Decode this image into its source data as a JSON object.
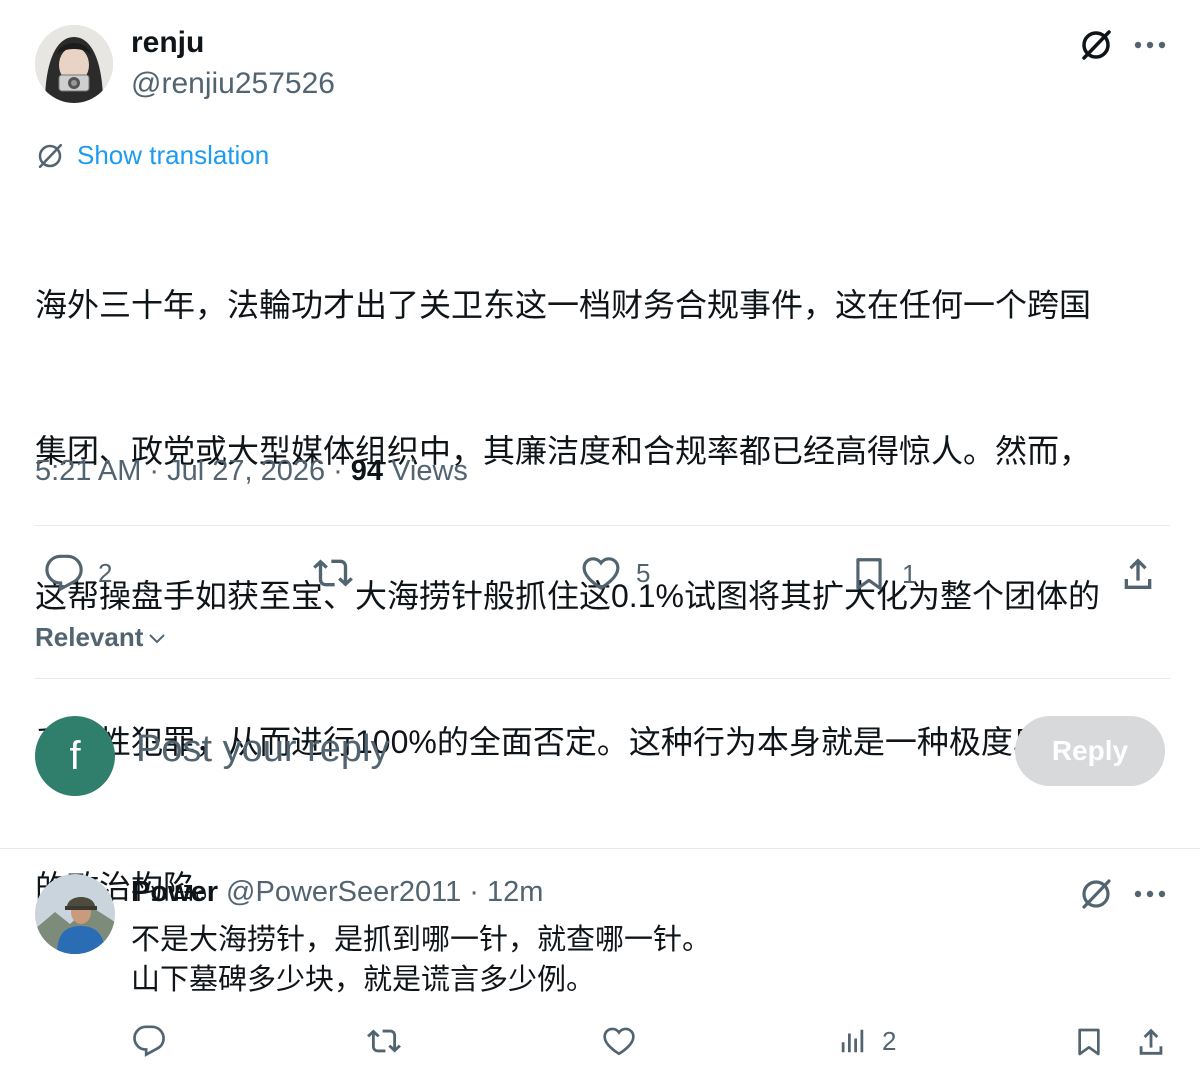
{
  "post": {
    "author": {
      "display_name": "renju",
      "handle": "@renjiu257526",
      "avatar": "avatar-photo"
    },
    "translate_label": "Show translation",
    "text": "海外三十年，法輪功才出了关卫东这一档财务合规事件，这在任何一个跨国集团、政党或大型媒体组织中，其廉洁度和合规率都已经高得惊人。然而，这帮操盘手如获至宝、大海捞针般抓住这0.1%试图将其扩大化为整个团体的系统性犯罪，从而进行100%的全面否定。这种行为本身就是一种极度卑劣的政治构陷。",
    "text_lines": [
      "海外三十年，法輪功才出了关卫东这一档财务合规事件，这在任何一个跨国",
      "集团、政党或大型媒体组织中，其廉洁度和合规率都已经高得惊人。然而，",
      "这帮操盘手如获至宝、大海捞针般抓住这0.1%试图将其扩大化为整个团体的",
      "系统性犯罪，从而进行100%的全面否定。这种行为本身就是一种极度卑劣",
      "的政治构陷。"
    ],
    "time": "5:21 AM",
    "date": "Jul 27, 2026",
    "separator": "·",
    "views_count": "94",
    "views_label": "Views",
    "actions": {
      "replies": "2",
      "reposts": "",
      "likes": "5",
      "bookmarks": "1"
    }
  },
  "sort": {
    "label": "Relevant"
  },
  "composer": {
    "avatar_letter": "f",
    "placeholder": "Post your reply",
    "button_label": "Reply",
    "avatar_color": "#2f7f6c"
  },
  "reply": {
    "author": {
      "display_name": "Power",
      "handle": "@PowerSeer2011",
      "time": "12m"
    },
    "separator": "·",
    "lines": [
      "不是大海捞针，是抓到哪一针，就查哪一针。",
      "山下墓碑多少块，就是谎言多少例。"
    ],
    "actions": {
      "views": "2"
    }
  },
  "colors": {
    "link": "#1d9bf0",
    "secondary_text": "#536471",
    "primary_text": "#0f1419",
    "divider": "#e7e9eb",
    "reply_button_disabled": "#d7d9db"
  },
  "icons": [
    "grok-icon",
    "more-icon",
    "translate-icon",
    "reply-icon",
    "repost-icon",
    "like-icon",
    "bookmark-icon",
    "share-icon",
    "views-icon",
    "chevron-down-icon"
  ]
}
